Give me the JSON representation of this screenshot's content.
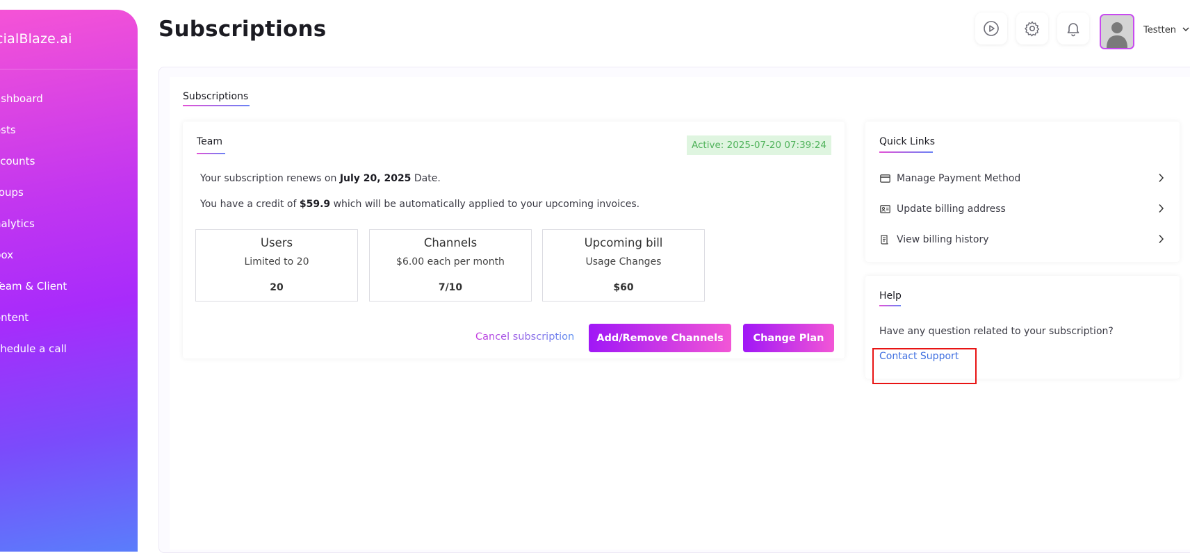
{
  "sidebar": {
    "brand": "cialBlaze.ai",
    "items": [
      {
        "label": "ashboard"
      },
      {
        "label": "osts"
      },
      {
        "label": "ccounts"
      },
      {
        "label": "roups"
      },
      {
        "label": "nalytics"
      },
      {
        "label": "box"
      },
      {
        "label": "Team & Client"
      },
      {
        "label": "ontent"
      },
      {
        "label": "chedule a call"
      }
    ]
  },
  "header": {
    "title": "Subscriptions",
    "icons": [
      "play-icon",
      "gear-icon",
      "bell-icon"
    ],
    "user_name": "Testten"
  },
  "tabs": {
    "active_label": "Subscriptions"
  },
  "plan_card": {
    "title": "Team",
    "status": "Active: 2025-07-20 07:39:24",
    "renew_prefix": "Your subscription renews on ",
    "renew_date": "July 20, 2025",
    "renew_suffix": " Date.",
    "credit_prefix": "You have a credit of ",
    "credit_amount": "$59.9",
    "credit_suffix": " which will be automatically applied to your upcoming invoices.",
    "stats": [
      {
        "title": "Users",
        "subtitle": "Limited to 20",
        "value": "20"
      },
      {
        "title": "Channels",
        "subtitle": "$6.00 each per month",
        "value": "7/10"
      },
      {
        "title": "Upcoming bill",
        "subtitle": "Usage Changes",
        "value": "$60"
      }
    ],
    "cancel_label": "Cancel subscription",
    "add_remove_label": "Add/Remove Channels",
    "change_plan_label": "Change Plan"
  },
  "quick_links": {
    "title": "Quick Links",
    "items": [
      {
        "label": "Manage Payment Method",
        "icon": "credit-card-icon"
      },
      {
        "label": "Update billing address",
        "icon": "address-card-icon"
      },
      {
        "label": "View billing history",
        "icon": "receipt-icon"
      }
    ]
  },
  "help": {
    "title": "Help",
    "question": "Have any question related to your subscription?",
    "contact_label": "Contact Support"
  },
  "colors": {
    "accent_purple": "#a017f6",
    "accent_pink": "#f256d6",
    "status_green": "#4fb25a",
    "link_blue": "#3f6fe0",
    "highlight_red": "#e81414"
  }
}
